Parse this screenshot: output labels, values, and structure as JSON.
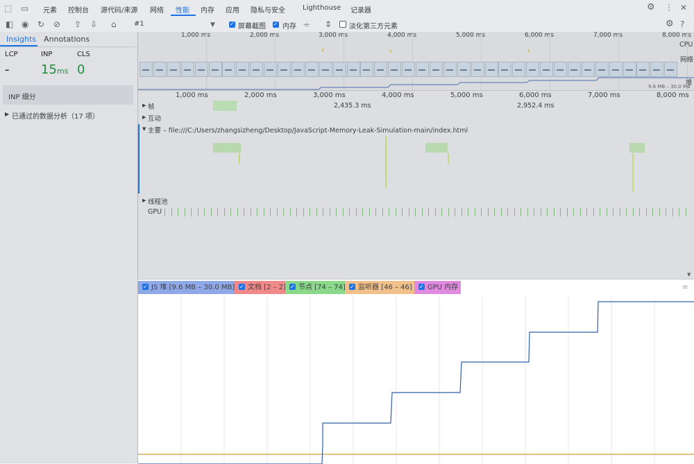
{
  "top_tabs": [
    "元素",
    "控制台",
    "源代码/来源",
    "网络",
    "性能",
    "内存",
    "应用",
    "隐私与安全",
    "Lighthouse",
    "记录器"
  ],
  "active_tab": "性能",
  "toolbar": {
    "recording_select": "#1",
    "screenshots_label": "屏幕截图",
    "memory_label": "内存",
    "dim_third_party_label": "淡化第三方元素"
  },
  "sidebar": {
    "tabs": [
      "Insights",
      "Annotations"
    ],
    "metrics": [
      {
        "label": "LCP",
        "value": "-",
        "unit": ""
      },
      {
        "label": "INP",
        "value": "15",
        "unit": "ms"
      },
      {
        "label": "CLS",
        "value": "0",
        "unit": ""
      }
    ],
    "inp_breakdown": "INP 细分",
    "passed_insights": "已通过的数据分析（17 项）"
  },
  "overview": {
    "ticks": [
      "1,000 ms",
      "2,000 ms",
      "3,000 ms",
      "4,000 ms",
      "5,000 ms",
      "6,000 ms",
      "7,000 ms",
      "8,000 ms"
    ],
    "lane_labels": {
      "cpu": "CPU",
      "network": "网络",
      "heap": "堆"
    },
    "heap_range": "9.6 MB – 30.0 MB"
  },
  "timeline": {
    "ticks": [
      "1,000 ms",
      "2,000 ms",
      "3,000 ms",
      "4,000 ms",
      "5,000 ms",
      "6,000 ms",
      "7,000 ms",
      "8,000 ms"
    ],
    "frames_label": "帧",
    "frame_durations": [
      "2,435.3 ms",
      "2,952.4 ms"
    ],
    "interactions_label": "互动",
    "main_label": "主要 – file:///C:/Users/zhangsizheng/Desktop/JavaScript-Memory-Leak-Simulation-main/index.html",
    "threadpool_label": "线程池",
    "gpu_label": "GPU"
  },
  "memory": {
    "legend": [
      {
        "label": "JS 堆 [9.6 MB – 30.0 MB]",
        "color": "#8fa8e8"
      },
      {
        "label": "文档 [2 – 2]",
        "color": "#f08a8a"
      },
      {
        "label": "节点 [74 – 74]",
        "color": "#8ad88a"
      },
      {
        "label": "监听器 [46 – 46]",
        "color": "#f2c08a"
      },
      {
        "label": "GPU 内存",
        "color": "#e08ae0"
      }
    ],
    "js_heap_line_color": "#2e5fa8",
    "listeners_line_color": "#d89a3c"
  }
}
